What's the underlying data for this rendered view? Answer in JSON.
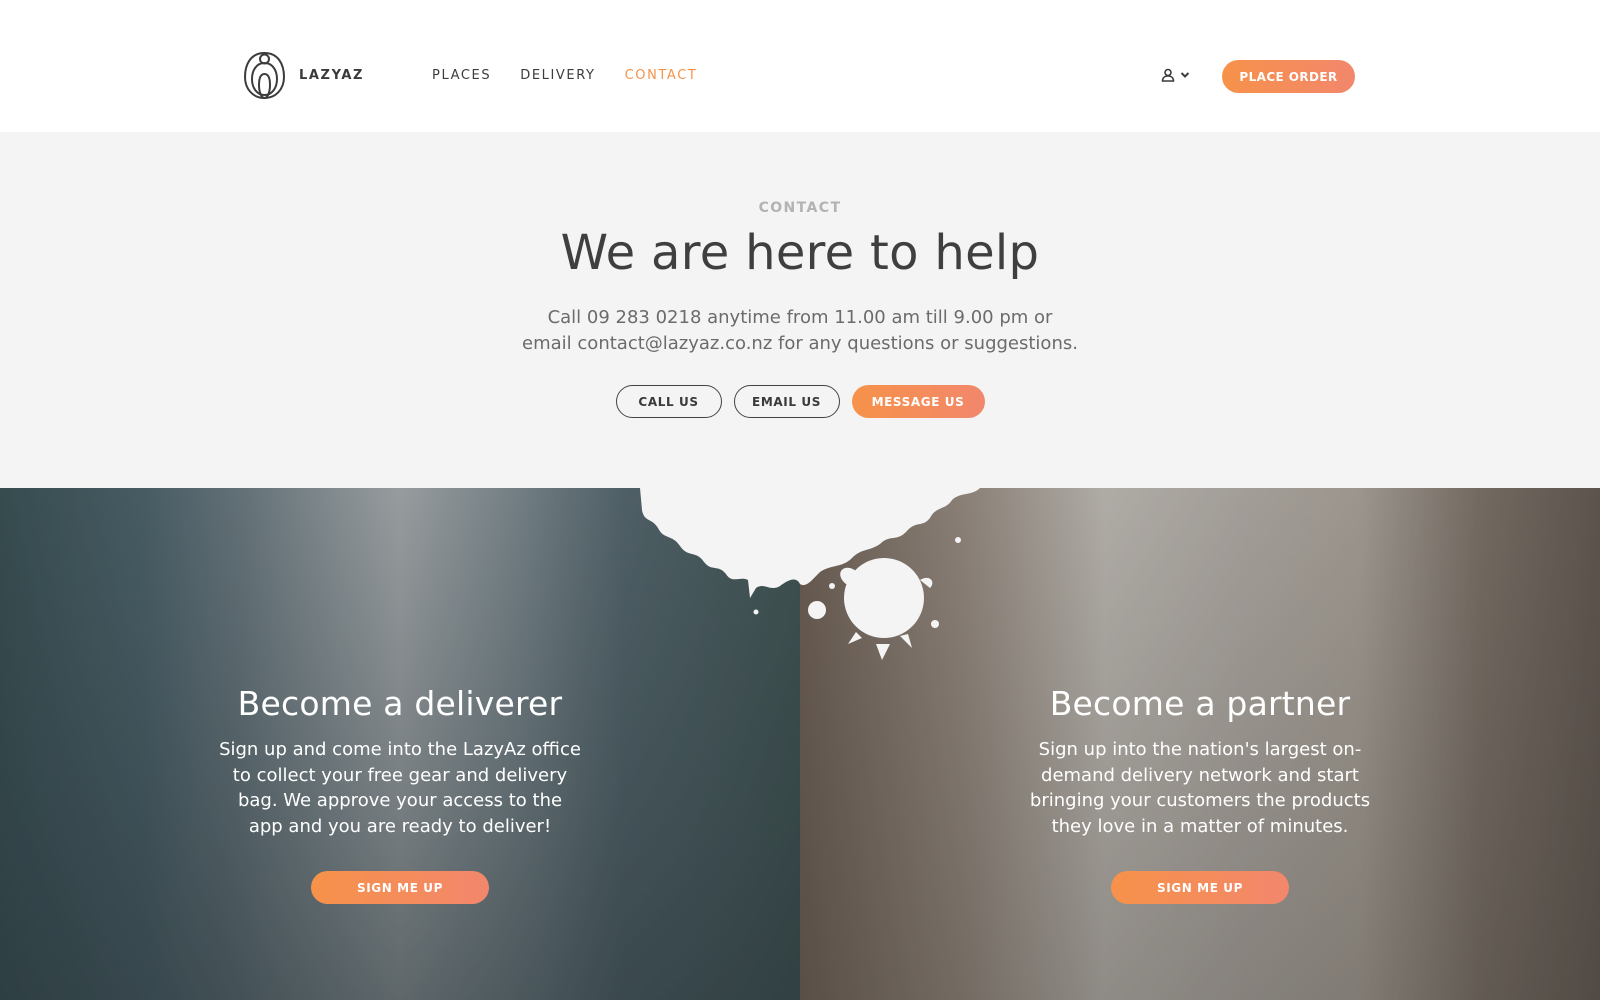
{
  "header": {
    "logo_text": "LAZYAZ",
    "nav": [
      {
        "label": "PLACES",
        "active": false
      },
      {
        "label": "DELIVERY",
        "active": false
      },
      {
        "label": "CONTACT",
        "active": true
      }
    ],
    "account_icon": "user-icon",
    "account_chevron": "chevron-down-icon",
    "order_label": "PLACE ORDER"
  },
  "hero": {
    "eyebrow": "CONTACT",
    "title": "We are here to help",
    "text_line1": "Call 09 283 0218 anytime from 11.00 am till 9.00 pm or",
    "text_line2": "email contact@lazyaz.co.nz for any questions or suggestions.",
    "buttons": {
      "call": "CALL US",
      "email": "EMAIL US",
      "message": "MESSAGE US"
    }
  },
  "panels": {
    "deliverer": {
      "title": "Become a deliverer",
      "lines": [
        "Sign up and come into the LazyAz office",
        "to collect your free gear and delivery",
        "bag. We approve your access to the",
        "app and you are ready to deliver!"
      ],
      "button": "SIGN ME UP"
    },
    "partner": {
      "title": "Become a partner",
      "lines": [
        "Sign up into the nation's largest on-",
        "demand delivery network and start",
        "bringing your customers the products",
        "they love in a matter of minutes."
      ],
      "button": "SIGN ME UP"
    }
  },
  "colors": {
    "accent": "#f4934c",
    "hero_bg": "#f4f4f4"
  }
}
